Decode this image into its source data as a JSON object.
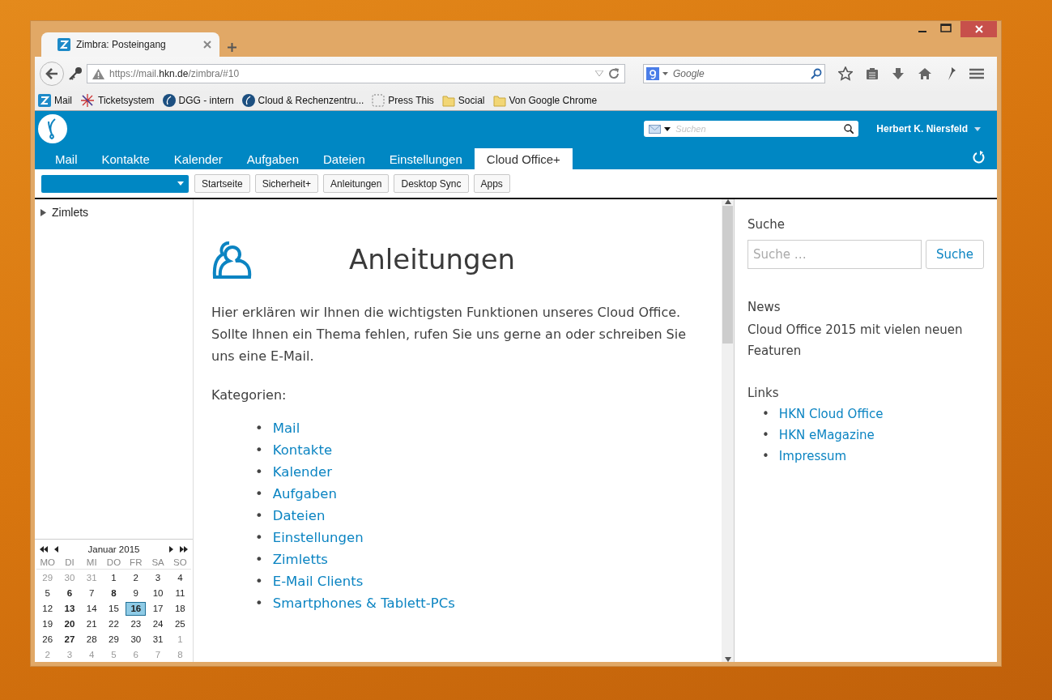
{
  "browser": {
    "tab_title": "Zimbra: Posteingang",
    "url": "https://mail.**hkn.de**/zimbra/#10",
    "search_placeholder": "Google",
    "bookmarks": [
      {
        "label": "Mail",
        "kind": "zimbra"
      },
      {
        "label": "Ticketsystem",
        "kind": "star"
      },
      {
        "label": "DGG - intern",
        "kind": "globe"
      },
      {
        "label": "Cloud & Rechenzentru...",
        "kind": "globe"
      },
      {
        "label": "Press This",
        "kind": "dashed"
      },
      {
        "label": "Social",
        "kind": "folder"
      },
      {
        "label": "Von Google Chrome",
        "kind": "folder"
      }
    ]
  },
  "app": {
    "search_placeholder": "Suchen",
    "user": "Herbert K. Niersfeld",
    "tabs": [
      {
        "label": "Mail",
        "selected": false
      },
      {
        "label": "Kontakte",
        "selected": false
      },
      {
        "label": "Kalender",
        "selected": false
      },
      {
        "label": "Aufgaben",
        "selected": false
      },
      {
        "label": "Dateien",
        "selected": false
      },
      {
        "label": "Einstellungen",
        "selected": false
      },
      {
        "label": "Cloud Office+",
        "selected": true
      }
    ],
    "toolbar_buttons": [
      "Startseite",
      "Sicherheit+",
      "Anleitungen",
      "Desktop Sync",
      "Apps"
    ],
    "tree": [
      {
        "label": "Zimlets",
        "expanded": false
      }
    ],
    "calendar": {
      "title": "Januar 2015",
      "weekdays": [
        "MO",
        "DI",
        "MI",
        "DO",
        "FR",
        "SA",
        "SO"
      ],
      "weeks": [
        [
          {
            "day": "29",
            "muted": true,
            "bold": false,
            "selected": false
          },
          {
            "day": "30",
            "muted": true,
            "bold": false,
            "selected": false
          },
          {
            "day": "31",
            "muted": true,
            "bold": false,
            "selected": false
          },
          {
            "day": "1",
            "muted": false,
            "bold": false,
            "selected": false
          },
          {
            "day": "2",
            "muted": false,
            "bold": false,
            "selected": false
          },
          {
            "day": "3",
            "muted": false,
            "bold": false,
            "selected": false
          },
          {
            "day": "4",
            "muted": false,
            "bold": false,
            "selected": false
          }
        ],
        [
          {
            "day": "5",
            "muted": false,
            "bold": false,
            "selected": false
          },
          {
            "day": "6",
            "muted": false,
            "bold": true,
            "selected": false
          },
          {
            "day": "7",
            "muted": false,
            "bold": false,
            "selected": false
          },
          {
            "day": "8",
            "muted": false,
            "bold": true,
            "selected": false
          },
          {
            "day": "9",
            "muted": false,
            "bold": false,
            "selected": false
          },
          {
            "day": "10",
            "muted": false,
            "bold": false,
            "selected": false
          },
          {
            "day": "11",
            "muted": false,
            "bold": false,
            "selected": false
          }
        ],
        [
          {
            "day": "12",
            "muted": false,
            "bold": false,
            "selected": false
          },
          {
            "day": "13",
            "muted": false,
            "bold": true,
            "selected": false
          },
          {
            "day": "14",
            "muted": false,
            "bold": false,
            "selected": false
          },
          {
            "day": "15",
            "muted": false,
            "bold": false,
            "selected": false
          },
          {
            "day": "16",
            "muted": false,
            "bold": true,
            "selected": true
          },
          {
            "day": "17",
            "muted": false,
            "bold": false,
            "selected": false
          },
          {
            "day": "18",
            "muted": false,
            "bold": false,
            "selected": false
          }
        ],
        [
          {
            "day": "19",
            "muted": false,
            "bold": false,
            "selected": false
          },
          {
            "day": "20",
            "muted": false,
            "bold": true,
            "selected": false
          },
          {
            "day": "21",
            "muted": false,
            "bold": false,
            "selected": false
          },
          {
            "day": "22",
            "muted": false,
            "bold": false,
            "selected": false
          },
          {
            "day": "23",
            "muted": false,
            "bold": false,
            "selected": false
          },
          {
            "day": "24",
            "muted": false,
            "bold": false,
            "selected": false
          },
          {
            "day": "25",
            "muted": false,
            "bold": false,
            "selected": false
          }
        ],
        [
          {
            "day": "26",
            "muted": false,
            "bold": false,
            "selected": false
          },
          {
            "day": "27",
            "muted": false,
            "bold": true,
            "selected": false
          },
          {
            "day": "28",
            "muted": false,
            "bold": false,
            "selected": false
          },
          {
            "day": "29",
            "muted": false,
            "bold": false,
            "selected": false
          },
          {
            "day": "30",
            "muted": false,
            "bold": false,
            "selected": false
          },
          {
            "day": "31",
            "muted": false,
            "bold": false,
            "selected": false
          },
          {
            "day": "1",
            "muted": true,
            "bold": false,
            "selected": false
          }
        ],
        [
          {
            "day": "2",
            "muted": true,
            "bold": false,
            "selected": false
          },
          {
            "day": "3",
            "muted": true,
            "bold": false,
            "selected": false
          },
          {
            "day": "4",
            "muted": true,
            "bold": false,
            "selected": false
          },
          {
            "day": "5",
            "muted": true,
            "bold": false,
            "selected": false
          },
          {
            "day": "6",
            "muted": true,
            "bold": false,
            "selected": false
          },
          {
            "day": "7",
            "muted": true,
            "bold": false,
            "selected": false
          },
          {
            "day": "8",
            "muted": true,
            "bold": false,
            "selected": false
          }
        ]
      ]
    }
  },
  "page": {
    "marker": "•",
    "title": "Anleitungen",
    "intro": "Hier erklären wir Ihnen die wichtigsten Funktionen unseres Cloud Office. Sollte Ihnen ein Thema fehlen, rufen Sie uns gerne an oder schreiben Sie uns eine E-Mail.",
    "categories_label": "Kategorien:",
    "categories": [
      "Mail",
      "Kontakte",
      "Kalender",
      "Aufgaben",
      "Dateien",
      "Einstellungen",
      "Zimletts",
      "E-Mail Clients",
      "Smartphones & Tablett-PCs"
    ]
  },
  "sidebar": {
    "marker": "•",
    "search_label": "Suche",
    "search_placeholder": "Suche …",
    "search_button": "Suche",
    "news_title": "News",
    "news_text": "Cloud Office 2015 mit vielen neuen Featuren",
    "links_title": "Links",
    "links": [
      "HKN Cloud Office",
      "HKN eMagazine",
      "Impressum"
    ]
  }
}
